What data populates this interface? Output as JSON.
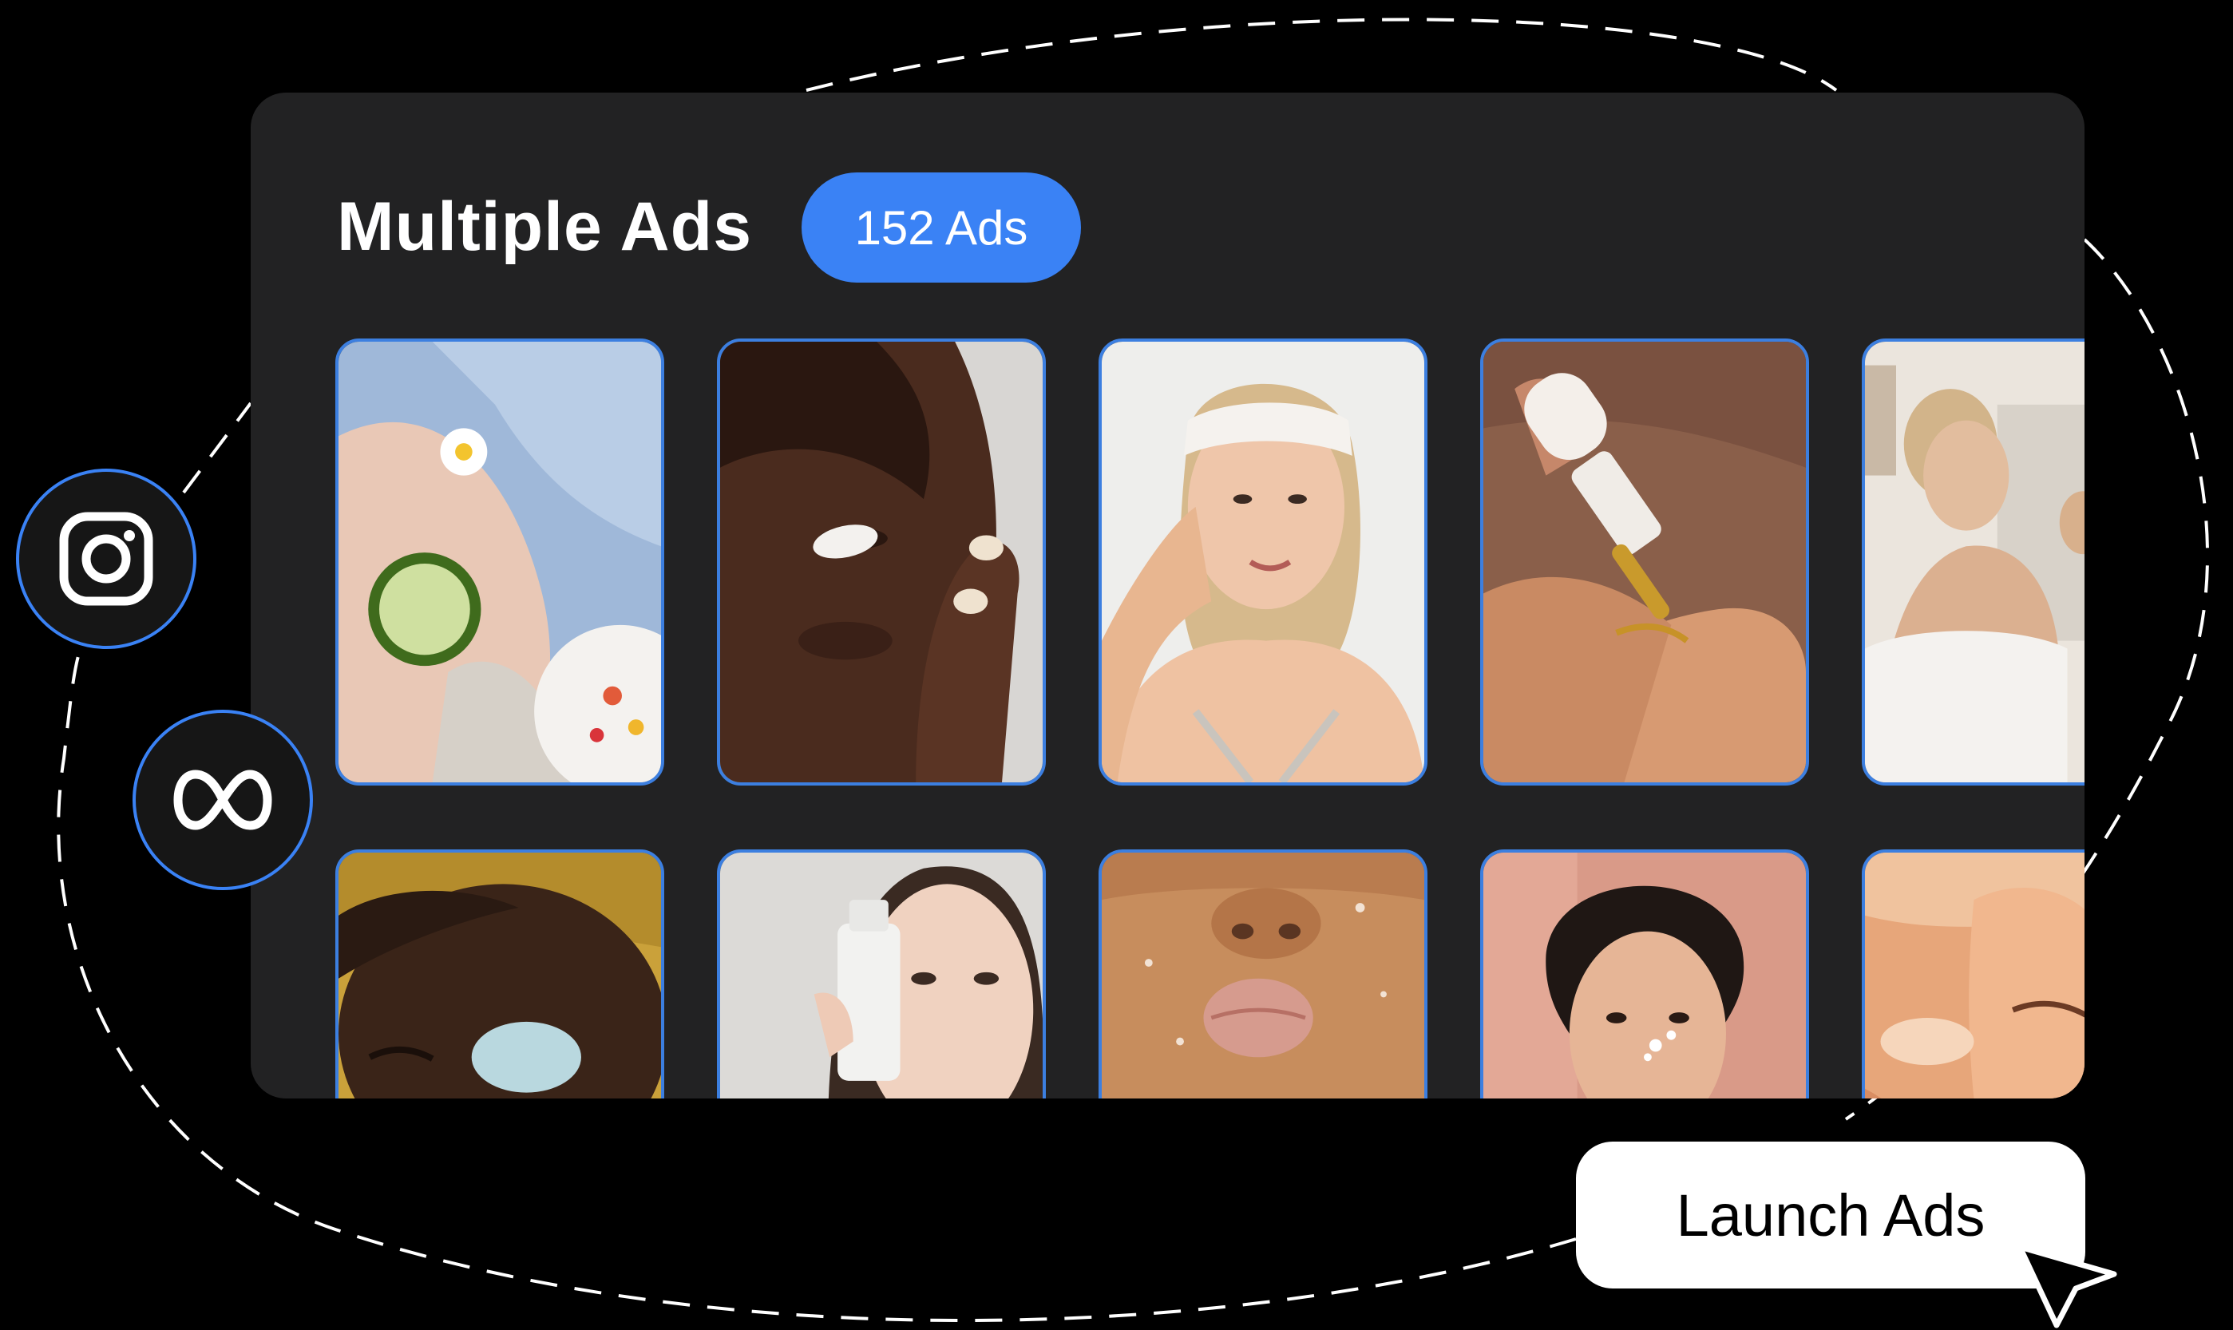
{
  "panel": {
    "title": "Multiple Ads",
    "ad_count_badge": "152 Ads"
  },
  "ad_grid": {
    "rows": [
      [
        {
          "subject": "woman with cucumber slice on eye and daisy, towel wrap, fruit bowl"
        },
        {
          "subject": "woman applying white cream to cheek"
        },
        {
          "subject": "smiling woman with headband"
        },
        {
          "subject": "dropper dispensing serum onto hand"
        },
        {
          "subject": "woman in towel at bathroom mirror"
        }
      ],
      [
        {
          "subject": "man with blue face mask, eyes closed"
        },
        {
          "subject": "woman holding skincare bottle"
        },
        {
          "subject": "close-up of lips with water drops"
        },
        {
          "subject": "short-haired woman with cream dots under eye"
        },
        {
          "subject": "face with peach-toned glow"
        }
      ]
    ]
  },
  "socials": {
    "first": "instagram-icon",
    "second": "meta-icon"
  },
  "launch_button": {
    "label": "Launch Ads"
  },
  "colors": {
    "accent": "#3a82f5",
    "panel": "#222223",
    "background": "#000000"
  }
}
